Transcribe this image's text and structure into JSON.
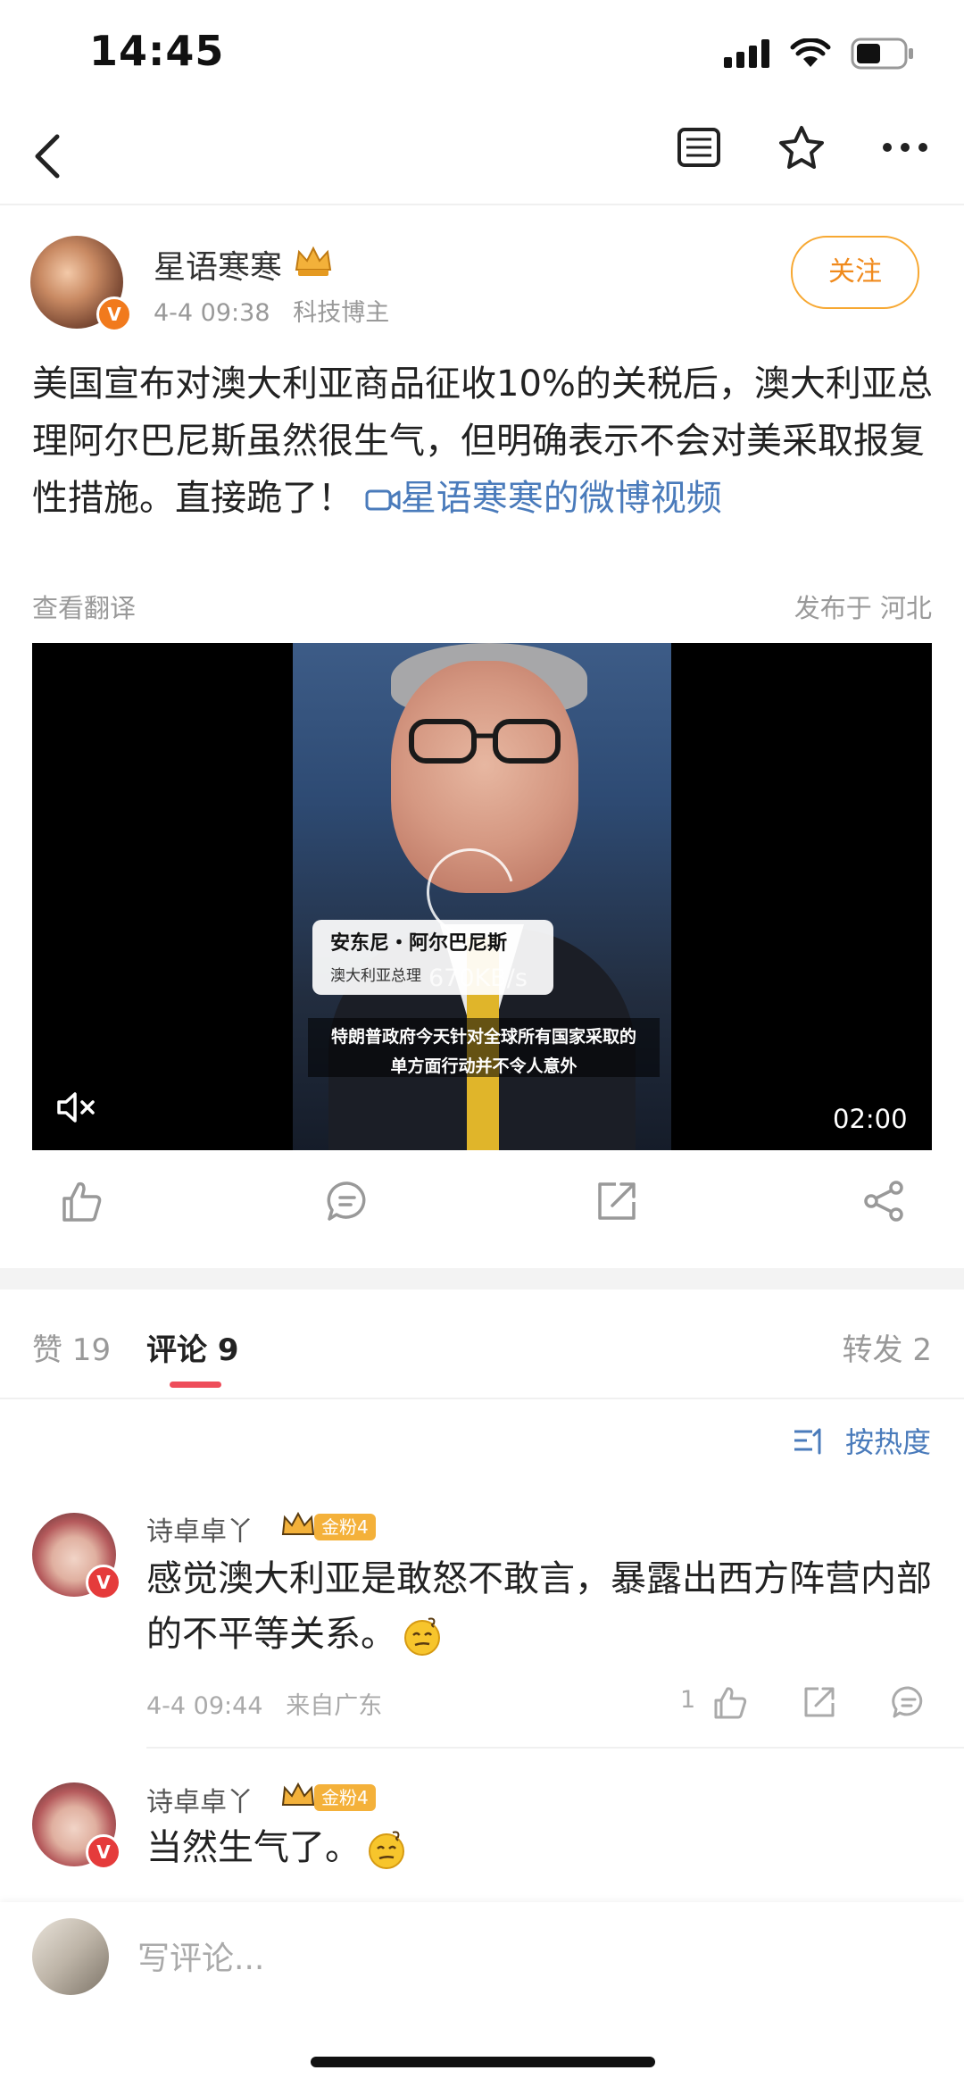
{
  "status_bar": {
    "time": "14:45"
  },
  "nav": {
    "back": "chevron-left-icon",
    "icons": [
      "article-icon",
      "star-icon",
      "more-icon"
    ]
  },
  "post": {
    "author": "星语寒寒",
    "time": "4-4 09:38",
    "author_tag": "科技博主",
    "follow_label": "关注",
    "text": "美国宣布对澳大利亚商品征收10%的关税后，澳大利亚总理阿尔巴尼斯虽然很生气，但明确表示不会对美采取报复性措施。直接跪了！",
    "video_link": "星语寒寒的微博视频",
    "translate_label": "查看翻译",
    "location": "发布于 河北",
    "verified_badge": "V"
  },
  "video": {
    "name_card": "安东尼・阿尔巴尼斯",
    "name_title": "澳大利亚总理",
    "speed": "670KB/s",
    "subtitle_line1": "特朗普政府今天针对全球所有国家采取的",
    "subtitle_line2": "单方面行动并不令人意外",
    "duration": "02:00"
  },
  "actions": [
    "like-icon",
    "comment-icon",
    "forward-icon",
    "share-icon"
  ],
  "tabs": {
    "likes": "赞 19",
    "comments": "评论 9",
    "reposts": "转发 2"
  },
  "sort": {
    "label": "按热度"
  },
  "comments": [
    {
      "user": "诗卓卓丫",
      "badge": "金粉4",
      "text": "感觉澳大利亚是敢怒不敢言，暴露出西方阵营内部的不平等关系。",
      "time": "4-4 09:44",
      "from": "来自广东",
      "likes": "1"
    },
    {
      "user": "诗卓卓丫",
      "badge": "金粉4",
      "text": "当然生气了。"
    }
  ],
  "bottom_bar": {
    "placeholder": "写评论..."
  }
}
